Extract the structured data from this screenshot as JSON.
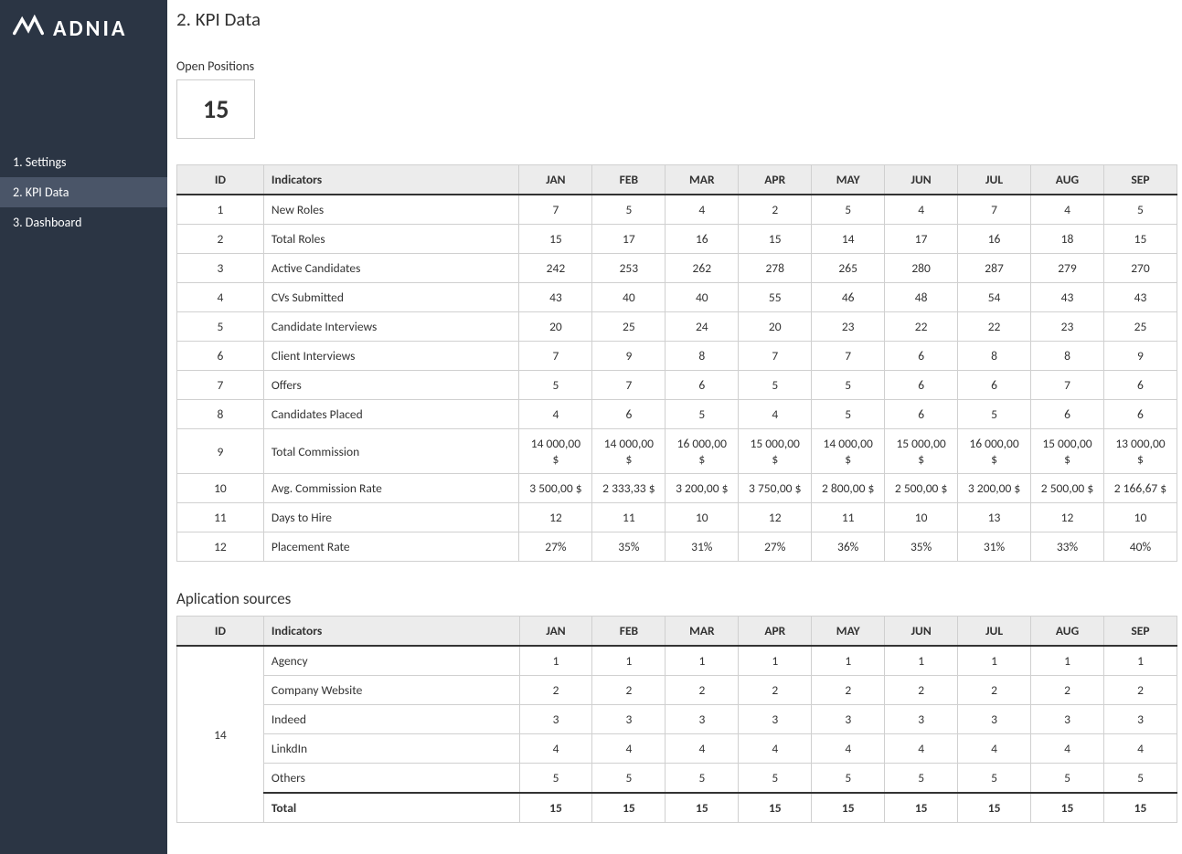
{
  "brand": "ADNIA",
  "nav": {
    "settings": "1. Settings",
    "kpidata": "2. KPI Data",
    "dashboard": "3. Dashboard"
  },
  "page_title": "2. KPI Data",
  "open_positions_label": "Open Positions",
  "open_positions_value": "15",
  "months": [
    "JAN",
    "FEB",
    "MAR",
    "APR",
    "MAY",
    "JUN",
    "JUL",
    "AUG",
    "SEP"
  ],
  "headers": {
    "id": "ID",
    "indicators": "Indicators"
  },
  "kpi_rows": [
    {
      "id": "1",
      "label": "New Roles",
      "vals": [
        "7",
        "5",
        "4",
        "2",
        "5",
        "4",
        "7",
        "4",
        "5"
      ]
    },
    {
      "id": "2",
      "label": "Total Roles",
      "vals": [
        "15",
        "17",
        "16",
        "15",
        "14",
        "17",
        "16",
        "18",
        "15"
      ]
    },
    {
      "id": "3",
      "label": "Active Candidates",
      "vals": [
        "242",
        "253",
        "262",
        "278",
        "265",
        "280",
        "287",
        "279",
        "270"
      ]
    },
    {
      "id": "4",
      "label": "CVs Submitted",
      "vals": [
        "43",
        "40",
        "40",
        "55",
        "46",
        "48",
        "54",
        "43",
        "43"
      ]
    },
    {
      "id": "5",
      "label": "Candidate Interviews",
      "vals": [
        "20",
        "25",
        "24",
        "20",
        "23",
        "22",
        "22",
        "23",
        "25"
      ]
    },
    {
      "id": "6",
      "label": "Client Interviews",
      "vals": [
        "7",
        "9",
        "8",
        "7",
        "7",
        "6",
        "8",
        "8",
        "9"
      ]
    },
    {
      "id": "7",
      "label": "Offers",
      "vals": [
        "5",
        "7",
        "6",
        "5",
        "5",
        "6",
        "6",
        "7",
        "6"
      ]
    },
    {
      "id": "8",
      "label": "Candidates Placed",
      "vals": [
        "4",
        "6",
        "5",
        "4",
        "5",
        "6",
        "5",
        "6",
        "6"
      ]
    },
    {
      "id": "9",
      "label": "Total Commission",
      "vals": [
        "14 000,00 $",
        "14 000,00 $",
        "16 000,00 $",
        "15 000,00 $",
        "14 000,00 $",
        "15 000,00 $",
        "16 000,00 $",
        "15 000,00 $",
        "13 000,00 $"
      ]
    },
    {
      "id": "10",
      "label": "Avg. Commission Rate",
      "vals": [
        "3 500,00 $",
        "2 333,33 $",
        "3 200,00 $",
        "3 750,00 $",
        "2 800,00 $",
        "2 500,00 $",
        "3 200,00 $",
        "2 500,00 $",
        "2 166,67 $"
      ]
    },
    {
      "id": "11",
      "label": "Days to Hire",
      "vals": [
        "12",
        "11",
        "10",
        "12",
        "11",
        "10",
        "13",
        "12",
        "10"
      ]
    },
    {
      "id": "12",
      "label": "Placement Rate",
      "vals": [
        "27%",
        "35%",
        "31%",
        "27%",
        "36%",
        "35%",
        "31%",
        "33%",
        "40%"
      ]
    }
  ],
  "sources_title": "Aplication sources",
  "sources_id": "14",
  "sources_rows": [
    {
      "label": "Agency",
      "vals": [
        "1",
        "1",
        "1",
        "1",
        "1",
        "1",
        "1",
        "1",
        "1"
      ]
    },
    {
      "label": "Company Website",
      "vals": [
        "2",
        "2",
        "2",
        "2",
        "2",
        "2",
        "2",
        "2",
        "2"
      ]
    },
    {
      "label": "Indeed",
      "vals": [
        "3",
        "3",
        "3",
        "3",
        "3",
        "3",
        "3",
        "3",
        "3"
      ]
    },
    {
      "label": "LinkdIn",
      "vals": [
        "4",
        "4",
        "4",
        "4",
        "4",
        "4",
        "4",
        "4",
        "4"
      ]
    },
    {
      "label": "Others",
      "vals": [
        "5",
        "5",
        "5",
        "5",
        "5",
        "5",
        "5",
        "5",
        "5"
      ]
    }
  ],
  "sources_total": {
    "label": "Total",
    "vals": [
      "15",
      "15",
      "15",
      "15",
      "15",
      "15",
      "15",
      "15",
      "15"
    ]
  }
}
